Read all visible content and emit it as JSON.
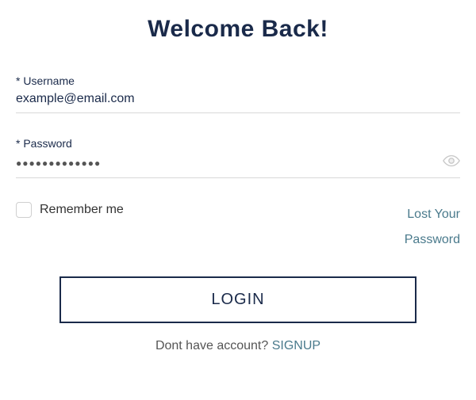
{
  "title": "Welcome Back!",
  "fields": {
    "username": {
      "label": "* Username",
      "value": "example@email.com"
    },
    "password": {
      "label": "* Password",
      "value": "●●●●●●●●●●●●●"
    }
  },
  "options": {
    "remember_label": "Remember me",
    "lost_password": "Lost Your Password"
  },
  "buttons": {
    "login": "LOGIN"
  },
  "signup": {
    "prompt": "Dont have account? ",
    "link": "SIGNUP"
  }
}
